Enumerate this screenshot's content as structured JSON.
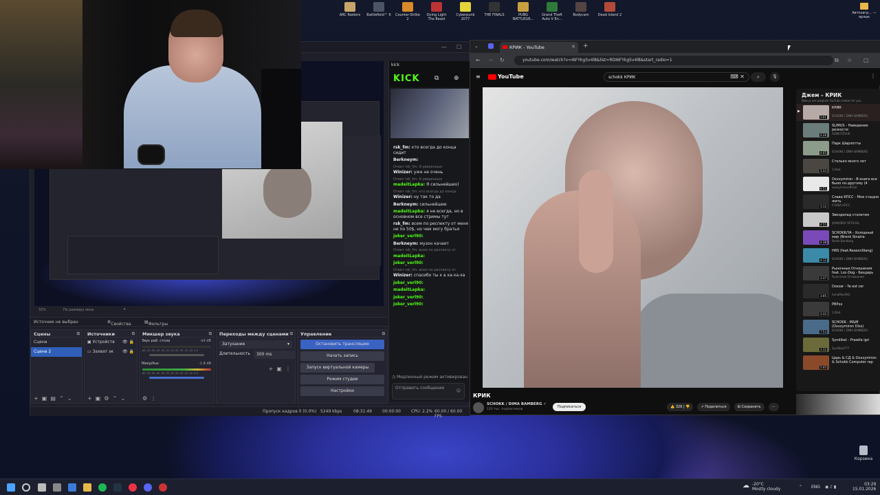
{
  "desktop_icons": [
    "ARC Raiders",
    "Battlefield™ 6",
    "Counter-Strike 2",
    "Dying Light The Beast",
    "Cyberpunk 2077",
    "THE FINALS",
    "PUBG BATTLEGR...",
    "Grand Theft Auto V En...",
    "Bodycam",
    "Dead Island 2"
  ],
  "desktop_right_icon": "Автозагр... — ярлык",
  "recycle_bin": "Корзина",
  "obs": {
    "zoom": "33%",
    "zoom_mode": "По размеру окна",
    "no_source": "Источник не выбран",
    "properties": "Свойства",
    "filters": "Фильтры",
    "scenes_title": "Сцены",
    "scenes": [
      "Сцена",
      "Сцена 2"
    ],
    "sources_title": "Источники",
    "sources": [
      "Устройств",
      "Захват эк"
    ],
    "mixer_title": "Микшер звука",
    "mixer": [
      {
        "name": "Звук раб. стола",
        "db": "-inf dB"
      },
      {
        "name": "Микр/Aux",
        "db": "-1.8 dB"
      }
    ],
    "meter_scale": "-60 -55 -50 -45 -40 -35 -30 -25 -20 -15 -10 -5 0",
    "transitions_title": "Переходы между сценами",
    "transition": "Затухание",
    "duration_label": "Длительность",
    "duration": "300 ms",
    "controls_title": "Управление",
    "controls": [
      "Остановить трансляцию",
      "Начать запись",
      "Запуск виртуальной камеры",
      "Режим студии",
      "Настройки"
    ],
    "status": {
      "dropped": "Пропуск кадров 0 (0.0%)",
      "bitrate": "5249 kbps",
      "live_time": "08:31:49",
      "rec_time": "00:00:00",
      "cpu": "CPU: 2.2%",
      "fps": "60.00 / 60.00 FPS"
    }
  },
  "kick": {
    "window_label": "kick",
    "logo": "KICK",
    "chat": [
      {
        "user": "rsk_fm:",
        "msg": "кто всегда до конца сидит"
      },
      {
        "user": "Berkneym:",
        "msg": ""
      },
      {
        "reply": "Ответ rsk_fm: Я уверенных",
        "user": "Winizer:",
        "msg": "уже не очень"
      },
      {
        "reply": "Ответ rsk_fm: Я уверенных",
        "user": "madeitLapka:",
        "msg": "Я сильнейших)"
      },
      {
        "reply": "Ответ rsk_fm: кто всегда до конца",
        "user": "Winizer:",
        "msg": "ну так то да"
      },
      {
        "user": "Berkneym:",
        "msg": "сильнейшие"
      },
      {
        "user": "madeitLapka:",
        "msg": "я не всегда, но в основном все стримы тут"
      },
      {
        "user": "rsk_fm:",
        "msg": "всем по респекту от меня не по 50$, но чем могу братья"
      },
      {
        "user": "joker_verl90:",
        "msg": ""
      },
      {
        "user": "Berkneym:",
        "msg": "музон качает"
      },
      {
        "reply": "Ответ rsk_fm: всем по респекту от",
        "user": "madeitLapka:",
        "msg": ""
      },
      {
        "user": "joker_verl90:",
        "msg": ""
      },
      {
        "reply": "Ответ rsk_fm: всем по респекту от",
        "user": "Winizer:",
        "msg": "спасибо ты х а ха-ха-ха"
      },
      {
        "user": "joker_verl90:",
        "msg": ""
      },
      {
        "user": "madeitLapka:",
        "msg": ""
      },
      {
        "user": "joker_verl90:",
        "msg": ""
      },
      {
        "user": "joker_verl90:",
        "msg": ""
      }
    ],
    "slow_mode": "Медленный режим активирован",
    "input_placeholder": "Отправить сообщение"
  },
  "browser": {
    "tab_title": "КРИК - YouTube",
    "url": "youtube.com/watch?v=I6FYkg5v4l8&list=RDI6FYkg5v4l8&start_radio=1",
    "search": "schokk КРИК",
    "logo": "YouTube",
    "video_title": "КРИК",
    "channel": "SCHOKK / DIMA BAMBERG",
    "subscribers": "120 тыс. подписчиков",
    "subscribe": "Подписаться",
    "likes": "326",
    "share": "Поделиться",
    "save": "Сохранить",
    "playlist_title": "Джем – КРИК",
    "playlist_sub": "Миксы are playlists YouTube makes for you",
    "playlist": [
      {
        "title": "КРИК",
        "artist": "SCHOKK / DIMA BAMBERG",
        "dur": "3:01",
        "color": "#b7aaa6",
        "current": true
      },
      {
        "title": "SLIMUS - Наведение резкости",
        "artist": "AZIMUTZVUK",
        "dur": "4:26",
        "color": "#6a7d7a"
      },
      {
        "title": "Парк Шарлотты",
        "artist": "SCHOKK / DIMA BAMBERG",
        "dur": "4:05",
        "color": "#8c9c8a"
      },
      {
        "title": "Столько много лет",
        "artist": "1.Kla$",
        "dur": "3:33",
        "color": "#4a4642"
      },
      {
        "title": "Oxxxymiron - В книге все было по-другому (4 раунд)",
        "artist": "oxxxymironofficial",
        "dur": "6:55",
        "color": "#e8e8e8"
      },
      {
        "title": "Слава КПСС - Мне стыдно жить",
        "artist": "СЛАВА КПСС",
        "dur": "3:13",
        "color": "#2a2a2a"
      },
      {
        "title": "Звездопад столетия",
        "artist": "JOHNYBOY OFFICIAL",
        "dur": "4:55",
        "color": "#c8c8c8"
      },
      {
        "title": "SCHOKK/YA - Холодный мир (Вrenk Sinatra instrumental)",
        "artist": "Brenk Bamberg",
        "dur": "4:38",
        "color": "#7a4ab8"
      },
      {
        "title": "HRS (feat.ReasonSlang)",
        "artist": "SCHOKK / DIMA BAMBERG",
        "dur": "4:12",
        "color": "#3a8aa8"
      },
      {
        "title": "Рыночные Отношения feat. Loc-Dog - Бездарь (Official)",
        "artist": "Рыночные Отношения",
        "dur": "3:37",
        "color": "#3a3a3a"
      },
      {
        "title": "Dossar - Ya est cer",
        "artist": "famaMan993",
        "dur": "3:05",
        "color": "#2a2a2a"
      },
      {
        "title": "PBPxx",
        "artist": "1.Kla$",
        "dur": "3:32",
        "color": "#3a3a3a"
      },
      {
        "title": "SCHOKK - M&M (Oxxxymiron Diss)",
        "artist": "SCHOKK / DIMA BAMBERG",
        "dur": "7:53",
        "color": "#4a6a8a"
      },
      {
        "title": "Syndikat - Prawila igri",
        "artist": "Syndikat777",
        "dur": "3:32",
        "color": "#6a6a3a"
      },
      {
        "title": "Царь & СД & Oxxxymiron & Schokk Computer rap",
        "artist": "",
        "dur": "5:05",
        "color": "#8a4a2a"
      }
    ]
  },
  "taskbar": {
    "weather_temp": "-20°C",
    "weather_desc": "Mostly cloudy",
    "lang": "ENG",
    "time": "03:29",
    "date": "15.01.2026"
  },
  "colors": {
    "kick_green": "#53fc18",
    "obs_blue": "#3a62c2",
    "yt_red": "#ff0000"
  }
}
